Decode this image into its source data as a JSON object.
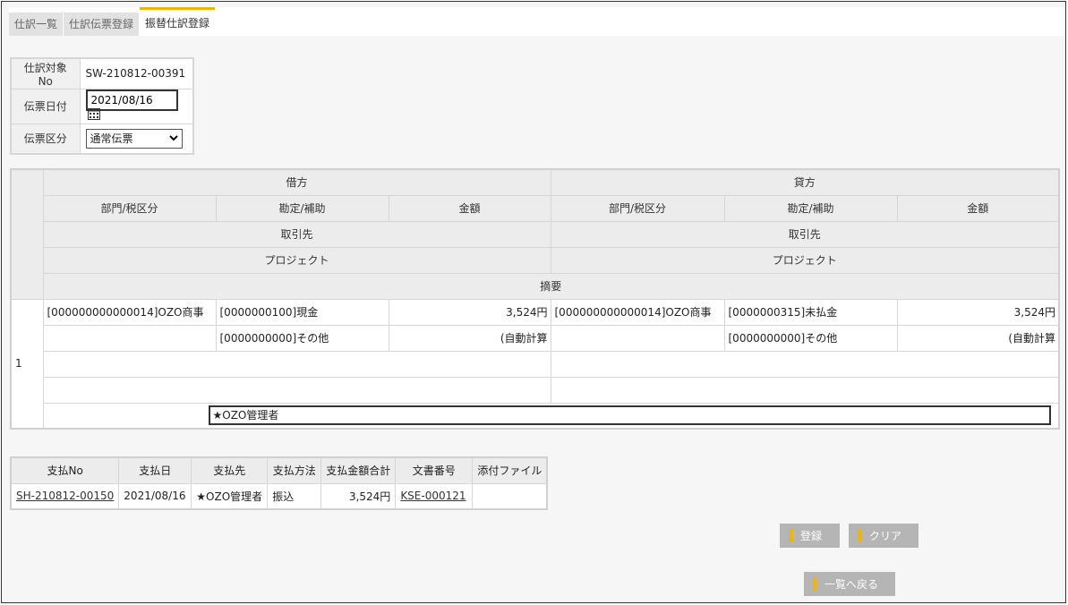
{
  "tabs": [
    "仕訳一覧",
    "仕訳伝票登録",
    "振替仕訳登録"
  ],
  "header": {
    "target_no_label": "仕訳対象No",
    "target_no_value": "SW-210812-00391",
    "date_label": "伝票日付",
    "date_value": "2021/08/16",
    "type_label": "伝票区分",
    "type_value": "通常伝票"
  },
  "grid": {
    "debit_label": "借方",
    "credit_label": "貸方",
    "dept_tax_label": "部門/税区分",
    "account_label": "勘定/補助",
    "amount_label": "金額",
    "partner_label": "取引先",
    "project_label": "プロジェクト",
    "memo_label": "摘要",
    "row": {
      "number": "1",
      "debit_dept": "[000000000000014]OZO商事",
      "debit_account": "[0000000100]現金",
      "debit_amount": "3,524円",
      "debit_account2": "[0000000000]その他",
      "debit_amount2": "(自動計算",
      "credit_dept": "[000000000000014]OZO商事",
      "credit_account": "[0000000315]未払金",
      "credit_amount": "3,524円",
      "credit_account2": "[0000000000]その他",
      "credit_amount2": "(自動計算",
      "memo": "★OZO管理者"
    }
  },
  "payment": {
    "headers": [
      "支払No",
      "支払日",
      "支払先",
      "支払方法",
      "支払金額合計",
      "文書番号",
      "添付ファイル"
    ],
    "row": {
      "no": "SH-210812-00150",
      "date": "2021/08/16",
      "payee": "★OZO管理者",
      "method": "振込",
      "total": "3,524円",
      "doc_no": "KSE-000121",
      "attachment": ""
    }
  },
  "buttons": {
    "register": "登録",
    "clear": "クリア",
    "back": "一覧へ戻る"
  },
  "colors": {
    "accent": "#f3b400",
    "button_bg": "#b5b5b5",
    "header_bg": "#ececec"
  }
}
